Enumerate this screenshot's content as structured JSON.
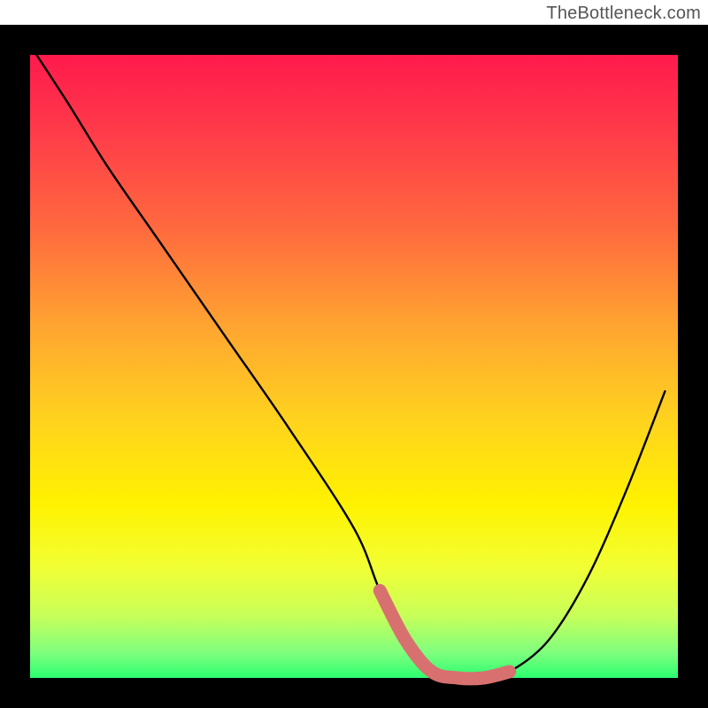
{
  "attribution": "TheBottleneck.com",
  "chart_data": {
    "type": "line",
    "title": "",
    "xlabel": "",
    "ylabel": "",
    "xlim": [
      0,
      100
    ],
    "ylim": [
      0,
      100
    ],
    "grid": false,
    "legend": false,
    "background": {
      "type": "vertical-gradient",
      "stops": [
        {
          "offset": 0.0,
          "color": "#ff1a4d"
        },
        {
          "offset": 0.12,
          "color": "#ff3a4a"
        },
        {
          "offset": 0.28,
          "color": "#ff6a3e"
        },
        {
          "offset": 0.44,
          "color": "#ffa630"
        },
        {
          "offset": 0.58,
          "color": "#ffd11f"
        },
        {
          "offset": 0.72,
          "color": "#fff200"
        },
        {
          "offset": 0.82,
          "color": "#f2ff33"
        },
        {
          "offset": 0.9,
          "color": "#c8ff5a"
        },
        {
          "offset": 0.96,
          "color": "#7eff7e"
        },
        {
          "offset": 1.0,
          "color": "#2bff70"
        }
      ]
    },
    "series": [
      {
        "name": "bottleneck-curve",
        "x": [
          1,
          6,
          12,
          20,
          30,
          40,
          50,
          54,
          58,
          62,
          66,
          70,
          74,
          80,
          86,
          92,
          98
        ],
        "values": [
          100,
          92,
          82,
          70,
          55,
          40,
          24,
          14,
          6,
          1,
          0,
          0,
          1,
          6,
          16,
          30,
          46
        ]
      }
    ],
    "flat_zone": {
      "note": "Thick salmon segment marking the optimal / near-zero bottleneck range",
      "x_start": 54,
      "x_end": 74,
      "color": "#d87070",
      "thickness_px": 15
    }
  }
}
